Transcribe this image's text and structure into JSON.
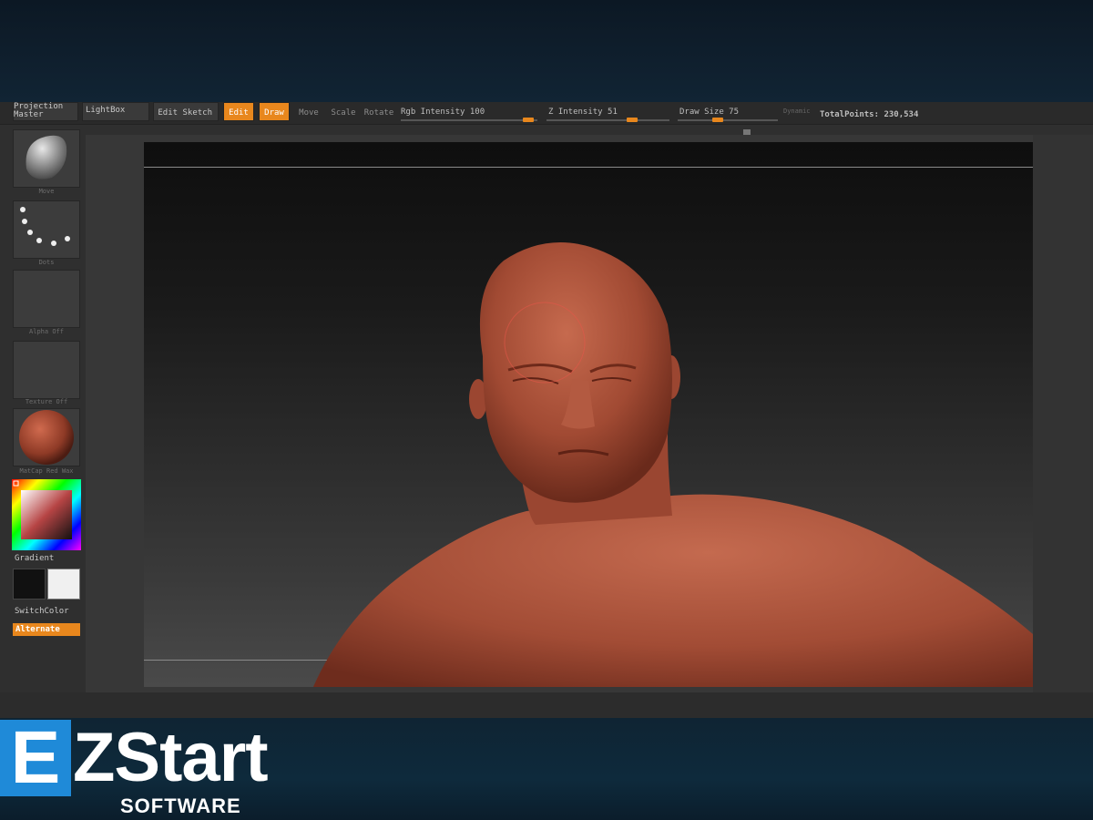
{
  "toolbar": {
    "projection_master_label": "Projection Master",
    "lightbox_label": "LightBox",
    "edit_sketch_label": "Edit Sketch",
    "edit_label": "Edit",
    "draw_label": "Draw",
    "move_label": "Move",
    "scale_label": "Scale",
    "rotate_label": "Rotate",
    "rgb_intensity": "Rgb  Intensity 100",
    "z_intensity": "Z  Intensity 51",
    "draw_size": "Draw  Size 75",
    "dynamic_label": "Dynamic",
    "total_points": "TotalPoints: 230,534"
  },
  "shelf": {
    "brush_caption": "Move",
    "stroke_caption": "Dots",
    "alpha_caption": "Alpha  Off",
    "texture_caption": "Texture  Off",
    "material_caption": "MatCap  Red  Wax",
    "gradient_label": "Gradient",
    "switchcolor_label": "SwitchColor",
    "alternate_label": "Alternate"
  },
  "logo": {
    "e_letter": "E",
    "rest": "ZStart",
    "sub": "SOFTWARE"
  },
  "colors": {
    "accent": "#e8871d",
    "clay": "#a9503a",
    "logo_blue": "#1f8ad8"
  }
}
